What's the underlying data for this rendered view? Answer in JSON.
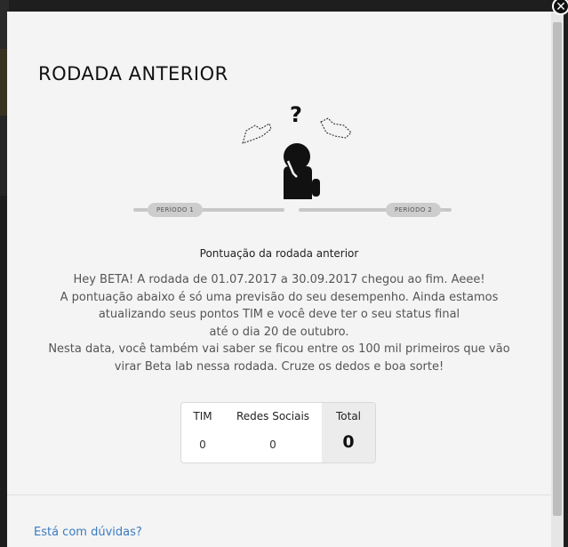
{
  "modal": {
    "title": "RODADA ANTERIOR",
    "close_glyph": "✕",
    "illustration": {
      "question_mark": "?",
      "icons": [
        "question-icon",
        "person-thinking-icon",
        "map-icon"
      ]
    },
    "progress": {
      "period_1": "PERÍODO 1",
      "period_2": "PERÍODO 2"
    },
    "subtitle": "Pontuação da rodada anterior",
    "body": {
      "line1": "Hey BETA! A rodada de 01.07.2017 a 30.09.2017 chegou ao fim. Aeee!",
      "line2": "A pontuação abaixo é só uma previsão do seu desempenho. Ainda estamos",
      "line3": "atualizando seus pontos TIM e você deve ter o seu status final",
      "line4": "até o dia 20 de outubro.",
      "line5": "Nesta data, você também vai saber se ficou entre os 100 mil primeiros que vão",
      "line6": "virar Beta lab nessa rodada. Cruze os dedos e boa sorte!"
    },
    "score": {
      "tim_label": "TIM",
      "tim_value": "0",
      "redes_label": "Redes Sociais",
      "redes_value": "0",
      "total_label": "Total",
      "total_value": "0"
    },
    "footer": {
      "help_link": "Está com dúvidas?"
    }
  },
  "colors": {
    "link": "#3a7bbf",
    "modal_bg": "#f4f4f4",
    "overlay": "#1e1e1e"
  }
}
